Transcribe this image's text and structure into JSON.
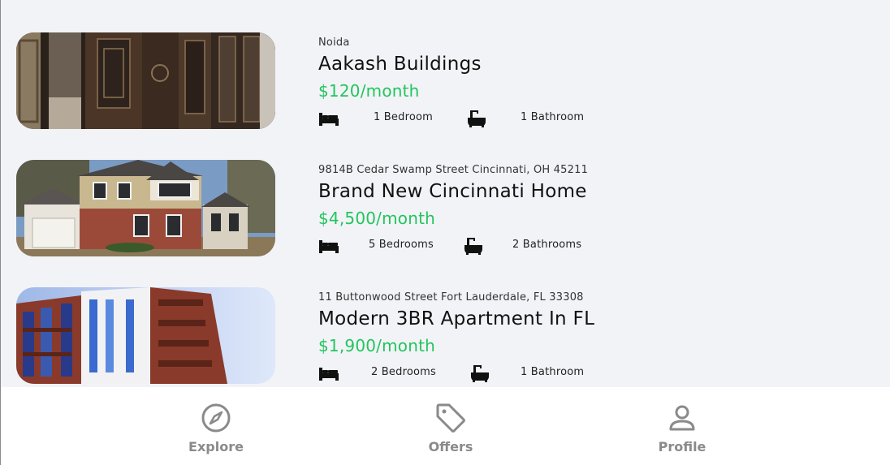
{
  "listings": [
    {
      "location": "Noida",
      "title": "Aakash Buildings",
      "price": "$120/month",
      "bedrooms": "1 Bedroom",
      "bathrooms": "1 Bathroom"
    },
    {
      "location": "9814B Cedar Swamp Street Cincinnati, OH 45211",
      "title": "Brand New Cincinnati Home",
      "price": "$4,500/month",
      "bedrooms": "5 Bedrooms",
      "bathrooms": "2 Bathrooms"
    },
    {
      "location": "11 Buttonwood Street Fort Lauderdale, FL 33308",
      "title": "Modern 3BR Apartment In FL",
      "price": "$1,900/month",
      "bedrooms": "2 Bedrooms",
      "bathrooms": "1 Bathroom"
    }
  ],
  "tabs": {
    "explore": {
      "label": "Explore",
      "icon": "compass-icon"
    },
    "offers": {
      "label": "Offers",
      "icon": "tag-icon"
    },
    "profile": {
      "label": "Profile",
      "icon": "user-icon"
    }
  },
  "colors": {
    "price": "#22c55e",
    "background": "#f2f3f7",
    "tab_inactive": "#8a8a8a"
  }
}
